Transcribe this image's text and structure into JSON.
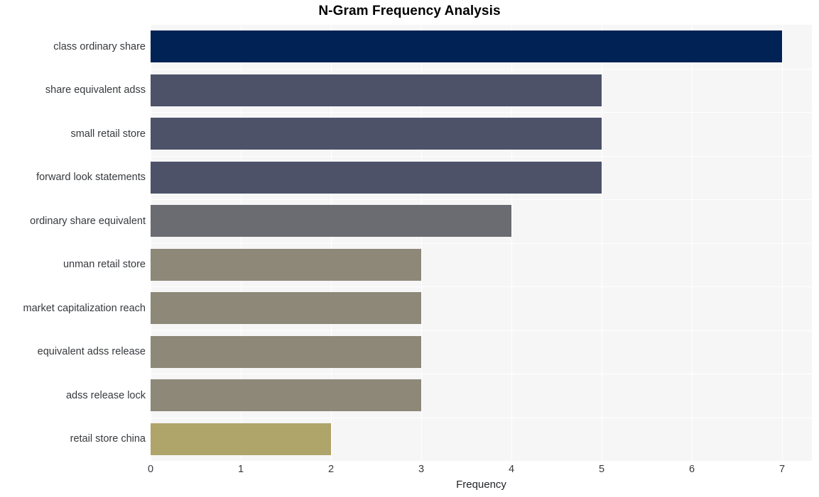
{
  "chart_data": {
    "type": "bar",
    "orientation": "horizontal",
    "title": "N-Gram Frequency Analysis",
    "xlabel": "Frequency",
    "ylabel": "",
    "categories": [
      "class ordinary share",
      "share equivalent adss",
      "small retail store",
      "forward look statements",
      "ordinary share equivalent",
      "unman retail store",
      "market capitalization reach",
      "equivalent adss release",
      "adss release lock",
      "retail store china"
    ],
    "values": [
      7,
      5,
      5,
      5,
      4,
      3,
      3,
      3,
      3,
      2
    ],
    "bar_colors": [
      "#002255",
      "#4d5269",
      "#4d5269",
      "#4d5269",
      "#6b6c72",
      "#8d8878",
      "#8d8878",
      "#8d8878",
      "#8d8878",
      "#afa46a"
    ],
    "xlim": [
      0,
      7.33
    ],
    "xticks": [
      0,
      1,
      2,
      3,
      4,
      5,
      6,
      7
    ],
    "xticklabels": [
      "0",
      "1",
      "2",
      "3",
      "4",
      "5",
      "6",
      "7"
    ],
    "grid": true,
    "grid_color": "#ffffff",
    "plot_background": "#f6f6f7",
    "figure_background": "#ffffff",
    "legend": null
  }
}
